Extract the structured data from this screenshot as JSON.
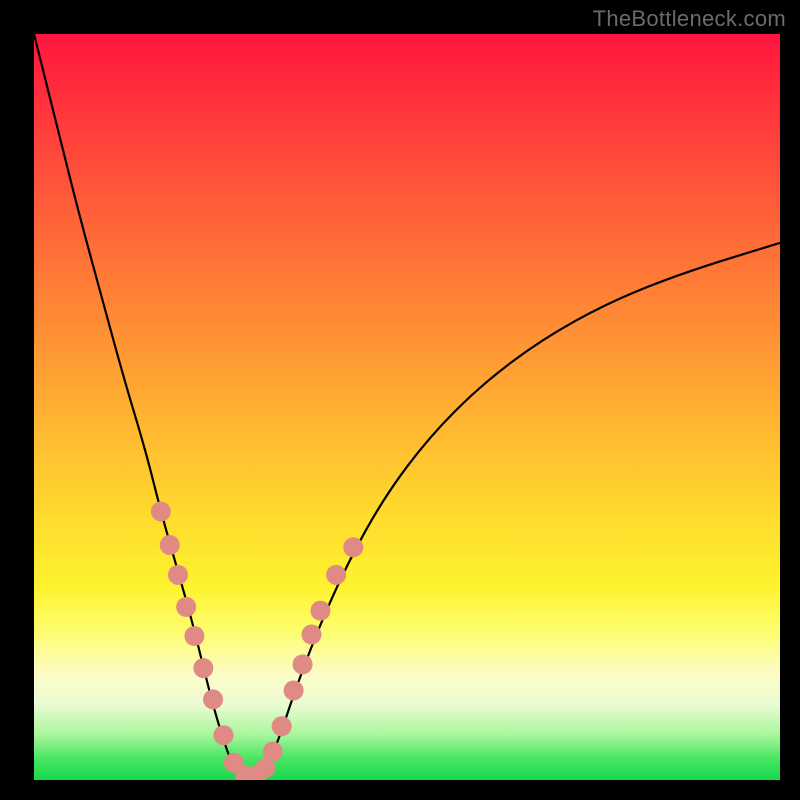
{
  "watermark": "TheBottleneck.com",
  "colors": {
    "frame": "#000000",
    "curve": "#000000",
    "dot": "#e08a86",
    "gradient_top": "#ff153e",
    "gradient_bottom": "#17d94e"
  },
  "chart_data": {
    "type": "line",
    "title": "",
    "xlabel": "",
    "ylabel": "",
    "xlim": [
      0,
      100
    ],
    "ylim": [
      0,
      100
    ],
    "series": [
      {
        "name": "left-branch",
        "x": [
          0,
          3,
          6,
          9,
          12,
          15,
          17,
          19,
          21,
          22.5,
          24,
          25.5,
          27
        ],
        "y": [
          100,
          88,
          76,
          65,
          54,
          44,
          36,
          29,
          22,
          16,
          10,
          5,
          1
        ]
      },
      {
        "name": "valley-floor",
        "x": [
          27,
          28,
          29,
          30,
          31
        ],
        "y": [
          1,
          0.5,
          0.5,
          0.5,
          1
        ]
      },
      {
        "name": "right-branch",
        "x": [
          31,
          33,
          35,
          38,
          42,
          47,
          53,
          60,
          68,
          77,
          87,
          100
        ],
        "y": [
          1,
          6,
          12,
          20,
          29,
          38,
          46,
          53,
          59,
          64,
          68,
          72
        ]
      }
    ],
    "scatter": [
      {
        "name": "dot",
        "x": 17.0,
        "y": 36.0
      },
      {
        "name": "dot",
        "x": 18.2,
        "y": 31.5
      },
      {
        "name": "dot",
        "x": 19.3,
        "y": 27.5
      },
      {
        "name": "dot",
        "x": 20.4,
        "y": 23.2
      },
      {
        "name": "dot",
        "x": 21.5,
        "y": 19.3
      },
      {
        "name": "dot",
        "x": 22.7,
        "y": 15.0
      },
      {
        "name": "dot",
        "x": 24.0,
        "y": 10.8
      },
      {
        "name": "dot",
        "x": 25.4,
        "y": 6.0
      },
      {
        "name": "dot",
        "x": 26.8,
        "y": 2.3
      },
      {
        "name": "dot",
        "x": 28.3,
        "y": 0.6
      },
      {
        "name": "dot",
        "x": 29.8,
        "y": 0.6
      },
      {
        "name": "dot",
        "x": 31.0,
        "y": 1.6
      },
      {
        "name": "dot",
        "x": 32.0,
        "y": 3.8
      },
      {
        "name": "dot",
        "x": 33.2,
        "y": 7.2
      },
      {
        "name": "dot",
        "x": 34.8,
        "y": 12.0
      },
      {
        "name": "dot",
        "x": 36.0,
        "y": 15.5
      },
      {
        "name": "dot",
        "x": 37.2,
        "y": 19.5
      },
      {
        "name": "dot",
        "x": 38.4,
        "y": 22.7
      },
      {
        "name": "dot",
        "x": 40.5,
        "y": 27.5
      },
      {
        "name": "dot",
        "x": 42.8,
        "y": 31.2
      }
    ]
  }
}
